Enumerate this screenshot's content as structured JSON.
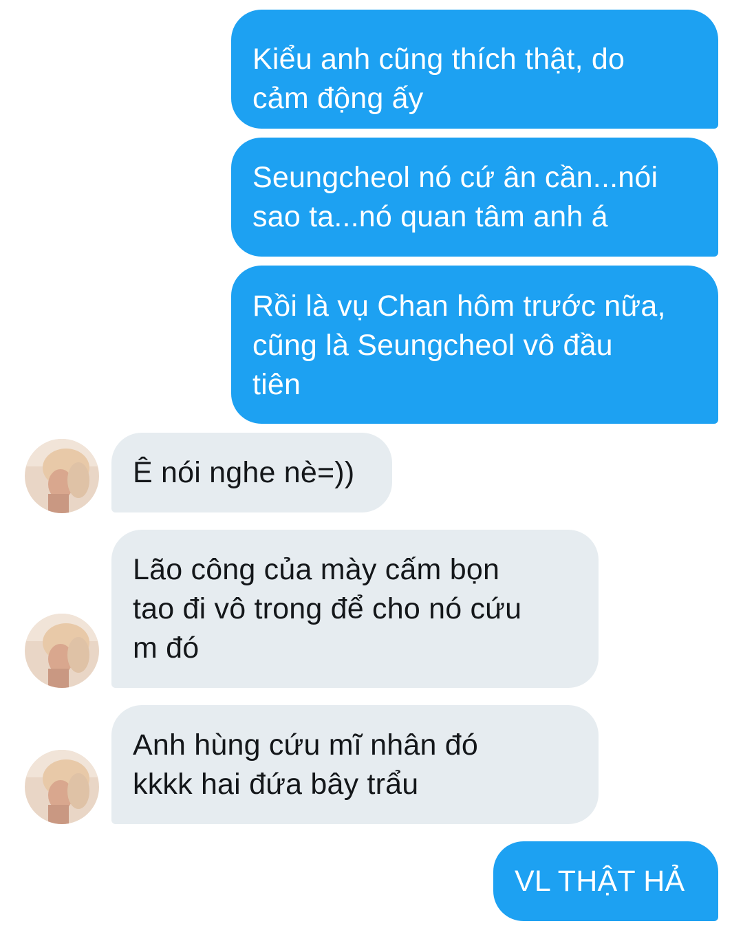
{
  "conversation": {
    "messages": [
      {
        "direction": "outgoing",
        "text": "Kiểu anh cũng thích thật, do\ncảm động ấy"
      },
      {
        "direction": "outgoing",
        "text": "Seungcheol nó cứ ân cần...nói\nsao ta...nó quan tâm anh á"
      },
      {
        "direction": "outgoing",
        "text": "Rồi là vụ Chan hôm trước nữa,\ncũng là Seungcheol vô đầu\ntiên"
      },
      {
        "direction": "incoming",
        "text": "Ê nói nghe nè=))"
      },
      {
        "direction": "incoming",
        "text": "Lão công của mày cấm bọn\ntao đi vô trong để cho nó cứu\nm đó"
      },
      {
        "direction": "incoming",
        "text": "Anh hùng cứu mĩ nhân đó\nkkkk hai đứa bây trẩu"
      },
      {
        "direction": "outgoing",
        "text": "VL THẬT HẢ"
      }
    ]
  },
  "colors": {
    "outgoing_bubble": "#1da1f2",
    "outgoing_text": "#ffffff",
    "incoming_bubble": "#e6ecf0",
    "incoming_text": "#14171a"
  },
  "icons": {
    "avatar": "contact-avatar-photo"
  }
}
